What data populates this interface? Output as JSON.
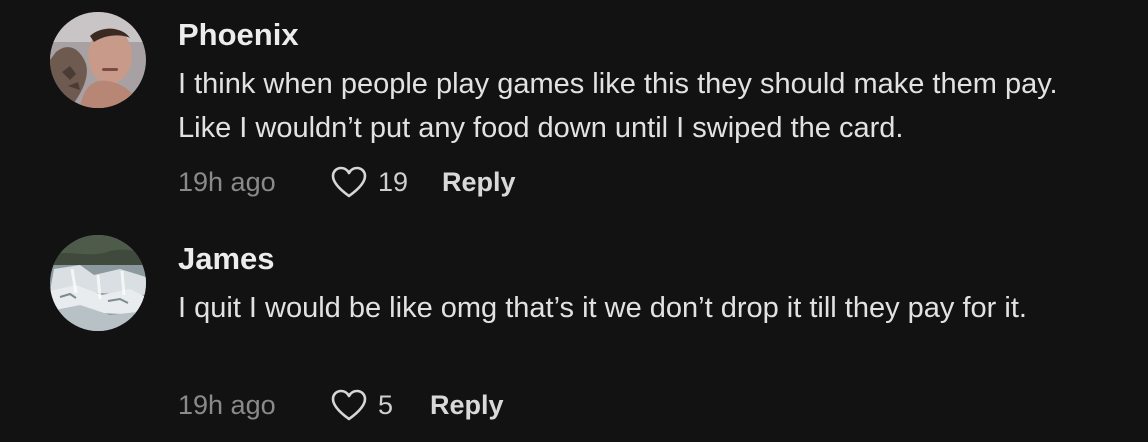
{
  "comments": [
    {
      "username": "Phoenix",
      "text": "I think when people play games like this they should make them pay. Like I wouldn’t put any food down until I swiped the card.",
      "timestamp": "19h ago",
      "like_count": "19",
      "reply_label": "Reply",
      "avatar_icon": "user-photo-avatar"
    },
    {
      "username": "James",
      "text": "I quit I would be like omg that’s it we don’t drop it till they pay for it.",
      "timestamp": "19h ago",
      "like_count": "5",
      "reply_label": "Reply",
      "avatar_icon": "waterfall-photo-avatar"
    }
  ],
  "colors": {
    "background": "#121212",
    "username": "#ececec",
    "body_text": "#e2e2e2",
    "timestamp": "#8a8a8a",
    "reply": "#d9d9d9"
  },
  "icons": {
    "like": "heart-outline-icon"
  }
}
